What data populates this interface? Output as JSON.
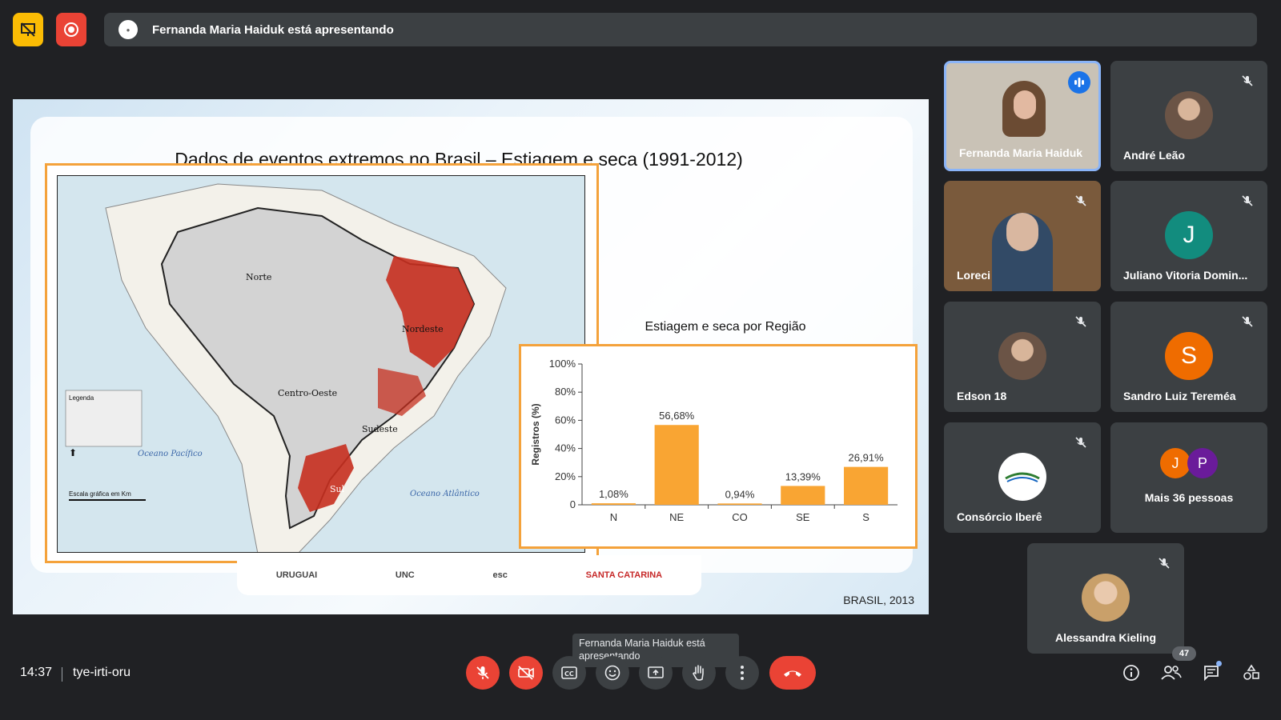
{
  "meeting": {
    "presenter_banner": "Fernanda Maria Haiduk está apresentando",
    "time": "14:37",
    "code": "tye-irti-oru",
    "tooltip": "Fernanda Maria Haiduk está apresentando",
    "participants_count": "47"
  },
  "slide": {
    "title": "Dados de eventos extremos no Brasil – Estiagem e seca (1991-2012)",
    "chart_title": "Estiagem e seca por Região",
    "credit": "BRASIL, 2013",
    "map_labels": {
      "norte": "Norte",
      "nordeste": "Nordeste",
      "centro_oeste": "Centro-Oeste",
      "sudeste": "Sudeste",
      "sul": "Sul",
      "oceano_pacifico": "Oceano Pacífico",
      "oceano_atlantico": "Oceano Atlântico",
      "legend_title": "Legenda",
      "scale": "Escala gráfica em Km"
    },
    "logos": [
      "URUGUAI",
      "UNC",
      "esc",
      "SANTA CATARINA"
    ]
  },
  "chart_data": {
    "type": "bar",
    "title": "Estiagem e seca por Região",
    "categories": [
      "N",
      "NE",
      "CO",
      "SE",
      "S"
    ],
    "values": [
      1.08,
      56.68,
      0.94,
      13.39,
      26.91
    ],
    "value_labels": [
      "1,08%",
      "56,68%",
      "0,94%",
      "13,39%",
      "26,91%"
    ],
    "ylabel": "Registros (%)",
    "ylim": [
      0,
      100
    ],
    "yticks": [
      "0",
      "20%",
      "40%",
      "60%",
      "80%",
      "100%"
    ],
    "bar_color": "#f9a533"
  },
  "participants": [
    {
      "name": "Fernanda Maria Haiduk",
      "type": "video",
      "speaking": true
    },
    {
      "name": "André Leão",
      "type": "photo"
    },
    {
      "name": "Loreci",
      "type": "video"
    },
    {
      "name": "Juliano Vitoria Domin...",
      "type": "letter",
      "letter": "J",
      "color": "#128c7e"
    },
    {
      "name": "Edson 18",
      "type": "photo"
    },
    {
      "name": "Sandro Luiz Tereméa",
      "type": "letter",
      "letter": "S",
      "color": "#ef6c00"
    },
    {
      "name": "Consórcio Iberê",
      "type": "photo"
    },
    {
      "name": "Mais 36 pessoas",
      "type": "group",
      "letters": [
        "J",
        "P"
      ]
    },
    {
      "name": "Alessandra Kieling",
      "type": "photo"
    }
  ],
  "colors": {
    "accent_blue": "#8ab4f8",
    "danger_red": "#ea4335",
    "warning_yellow": "#fbbc04",
    "tile_bg": "#3c4043"
  },
  "icons": {
    "present": "presentation-icon",
    "record": "record-icon",
    "mic": "mic-off-icon",
    "camera": "camera-off-icon",
    "captions": "captions-icon",
    "emoji": "emoji-icon",
    "share": "present-screen-icon",
    "hand": "raise-hand-icon",
    "more": "more-vert-icon",
    "hangup": "hangup-icon",
    "info": "info-icon",
    "people": "people-icon",
    "chat": "chat-icon",
    "activities": "activities-icon"
  }
}
